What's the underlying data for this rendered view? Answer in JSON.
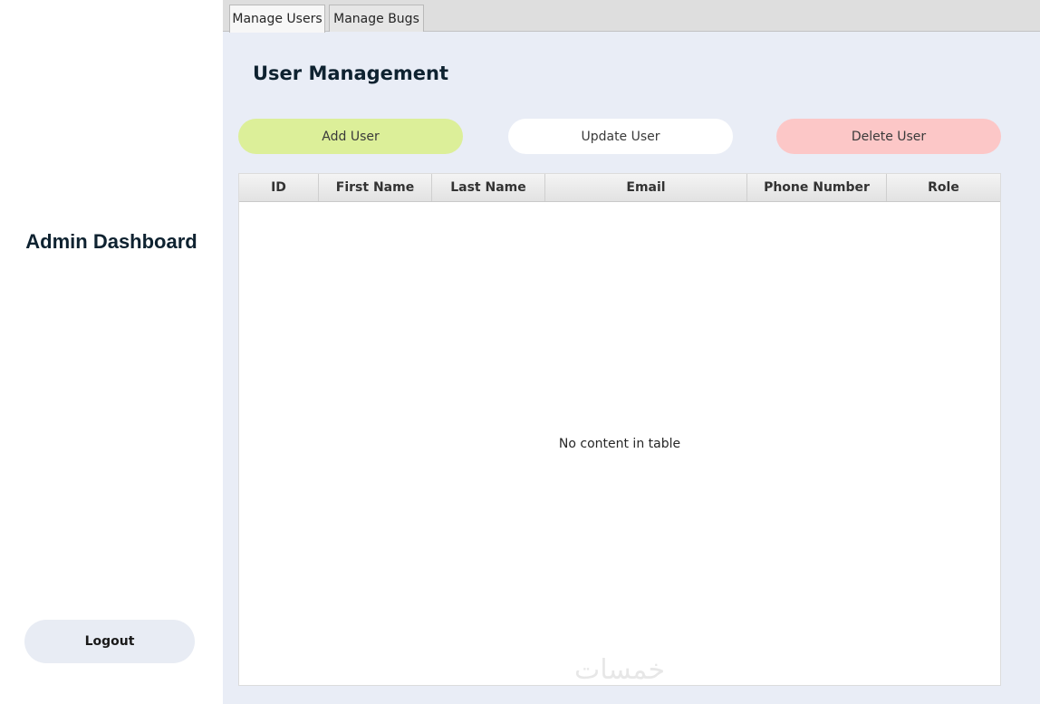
{
  "sidebar": {
    "title": "Admin Dashboard",
    "logout_label": "Logout"
  },
  "tabs": [
    {
      "label": "Manage Users",
      "active": true
    },
    {
      "label": "Manage Bugs",
      "active": false
    }
  ],
  "main": {
    "title": "User Management",
    "buttons": {
      "add": "Add User",
      "update": "Update User",
      "delete": "Delete User"
    },
    "table": {
      "columns": [
        "ID",
        "First Name",
        "Last Name",
        "Email",
        "Phone Number",
        "Role"
      ],
      "rows": [],
      "empty_message": "No content in table"
    }
  },
  "watermark": "خمسات",
  "colors": {
    "add_button": "#dcef99",
    "update_button": "#ffffff",
    "delete_button": "#fcc7c7",
    "main_background": "#e9edf6",
    "logout_button": "#e8ecf4",
    "title_text": "#0e2230"
  }
}
